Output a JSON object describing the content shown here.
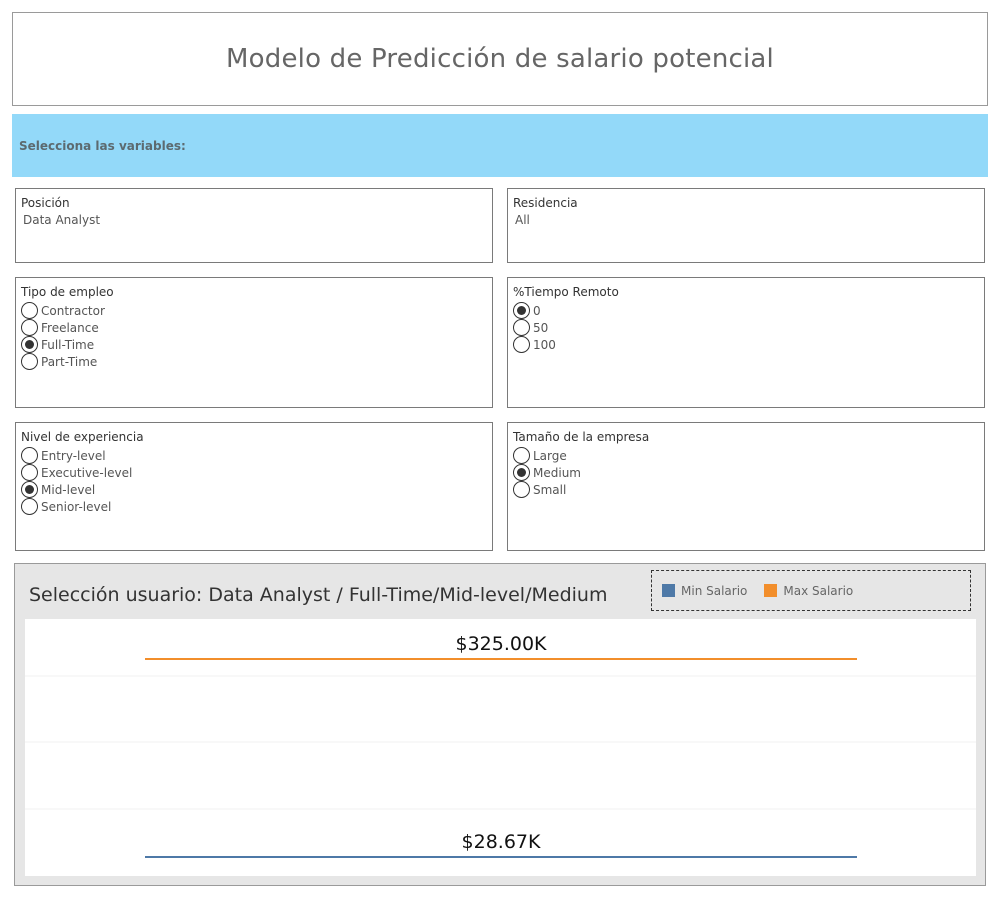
{
  "header": {
    "title": "Modelo de Predicción de salario potencial"
  },
  "banner": {
    "label": "Selecciona las variables:"
  },
  "filters": {
    "posicion": {
      "title": "Posición",
      "value": "Data Analyst"
    },
    "residencia": {
      "title": "Residencia",
      "value": "All"
    },
    "tipo_empleo": {
      "title": "Tipo de empleo",
      "options": [
        "Contractor",
        "Freelance",
        "Full-Time",
        "Part-Time"
      ],
      "selected": "Full-Time"
    },
    "tiempo_remoto": {
      "title": "%Tiempo Remoto",
      "options": [
        "0",
        "50",
        "100"
      ],
      "selected": "0"
    },
    "nivel_experiencia": {
      "title": "Nivel de experiencia",
      "options": [
        "Entry-level",
        "Executive-level",
        "Mid-level",
        "Senior-level"
      ],
      "selected": "Mid-level"
    },
    "tamano_empresa": {
      "title": "Tamaño de la empresa",
      "options": [
        "Large",
        "Medium",
        "Small"
      ],
      "selected": "Medium"
    }
  },
  "chart": {
    "title": "Selección usuario: Data Analyst / Full-Time/Mid-level/Medium",
    "legend": [
      {
        "label": "Min Salario",
        "color": "#4e79a7"
      },
      {
        "label": "Max Salario",
        "color": "#f28e2b"
      }
    ]
  },
  "chart_data": {
    "type": "bar",
    "categories": [
      "Data Analyst / Full-Time/Mid-level/Medium"
    ],
    "series": [
      {
        "name": "Max Salario",
        "values": [
          325000
        ],
        "label": "$325.00K",
        "color": "#f28e2b"
      },
      {
        "name": "Min Salario",
        "values": [
          28670
        ],
        "label": "$28.67K",
        "color": "#4e79a7"
      }
    ],
    "title": "Selección usuario: Data Analyst / Full-Time/Mid-level/Medium",
    "grid": true,
    "legend": "top-right"
  }
}
